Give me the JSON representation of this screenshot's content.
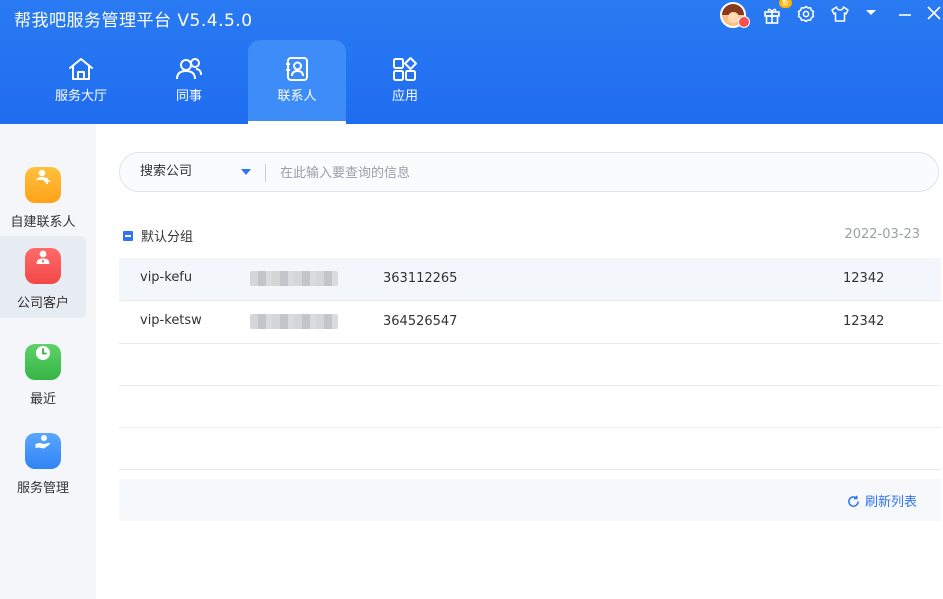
{
  "app": {
    "title": "帮我吧服务管理平台  V5.4.5.0"
  },
  "top_tabs": [
    {
      "label": "服务大厅",
      "icon": "home-icon",
      "active": false
    },
    {
      "label": "同事",
      "icon": "colleagues-icon",
      "active": false
    },
    {
      "label": "联系人",
      "icon": "contact-book-icon",
      "active": true
    },
    {
      "label": "应用",
      "icon": "apps-grid-icon",
      "active": false
    }
  ],
  "window_controls": {
    "gift_badge": "新",
    "icons": [
      "avatar",
      "gift-icon",
      "settings-icon",
      "skin-shirt-icon",
      "dropdown-arrow-icon",
      "minimize-icon",
      "close-icon"
    ]
  },
  "sidebar": {
    "items": [
      {
        "label": "自建联系人",
        "icon": "contact-add-icon",
        "color": "#ffb020",
        "active": false
      },
      {
        "label": "公司客户",
        "icon": "customer-icon",
        "color": "#f45454",
        "active": true
      },
      {
        "label": "最近",
        "icon": "clock-icon",
        "color": "#46bf52",
        "active": false
      },
      {
        "label": "服务管理",
        "icon": "service-hand-icon",
        "color": "#3d8ff8",
        "active": false
      }
    ]
  },
  "search": {
    "scope": "搜索公司",
    "placeholder": "在此输入要查询的信息",
    "value": ""
  },
  "group": {
    "name": "默认分组",
    "date": "2022-03-23"
  },
  "contacts": [
    {
      "name": "vip-kefu",
      "id": "363112265",
      "code": "12342"
    },
    {
      "name": "vip-ketsw",
      "id": "364526547",
      "code": "12342"
    }
  ],
  "footer": {
    "refresh_label": "刷新列表"
  },
  "colors": {
    "primary": "#1f6df0",
    "accent": "#2f74f5",
    "sidebar_bg": "#f4f6fa"
  }
}
